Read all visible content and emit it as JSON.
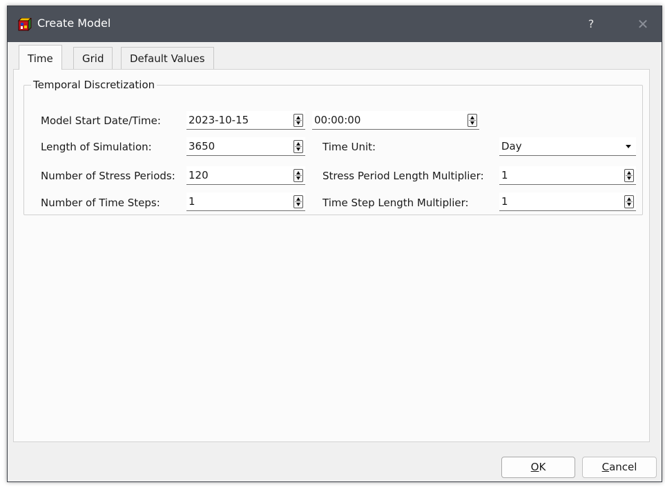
{
  "window": {
    "title": "Create Model",
    "help": "?",
    "close": "✕"
  },
  "tabs": [
    {
      "label": "Time",
      "active": true
    },
    {
      "label": "Grid",
      "active": false
    },
    {
      "label": "Default Values",
      "active": false
    }
  ],
  "group": {
    "title": "Temporal Discretization",
    "start_label": "Model Start Date/Time:",
    "start_date": "2023-10-15",
    "start_time": "00:00:00",
    "length_label": "Length of Simulation:",
    "length_value": "3650",
    "time_unit_label": "Time Unit:",
    "time_unit_value": "Day",
    "stress_periods_label": "Number of Stress Periods:",
    "stress_periods_value": "120",
    "sp_multiplier_label": "Stress Period Length Multiplier:",
    "sp_multiplier_value": "1",
    "time_steps_label": "Number of Time Steps:",
    "time_steps_value": "1",
    "ts_multiplier_label": "Time Step Length Multiplier:",
    "ts_multiplier_value": "1"
  },
  "buttons": {
    "ok_mnemonic": "O",
    "ok_rest": "K",
    "cancel_mnemonic": "C",
    "cancel_rest": "ancel"
  },
  "colors": {
    "titlebar": "#4b5059",
    "dialog_bg": "#f0f0f0",
    "panel_bg": "#fbfbfb"
  }
}
